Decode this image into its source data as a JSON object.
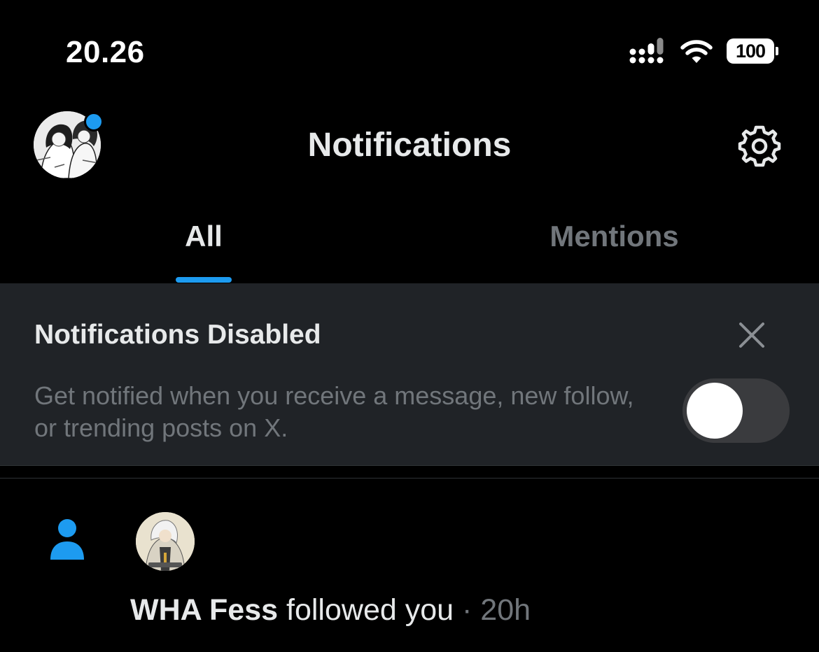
{
  "status_bar": {
    "time": "20.26",
    "battery": "100",
    "icons": [
      "signal-icon",
      "wifi-icon",
      "battery-icon"
    ]
  },
  "header": {
    "title": "Notifications",
    "settings_icon": "gear-icon",
    "has_unread_dot": true
  },
  "tabs": [
    {
      "label": "All",
      "active": true
    },
    {
      "label": "Mentions",
      "active": false
    }
  ],
  "banner": {
    "title": "Notifications Disabled",
    "description": "Get notified when you receive a message, new follow, or trending posts on X.",
    "toggle_on": false,
    "close_icon": "close-icon"
  },
  "notifications": [
    {
      "icon": "person-icon",
      "user": "WHA Fess",
      "action": "followed you",
      "separator": "·",
      "time": "20h"
    }
  ],
  "colors": {
    "background": "#000000",
    "accent": "#1d9bf0",
    "banner_bg": "#202327",
    "primary_text": "#e7e9ea",
    "secondary_text": "#71767b"
  }
}
